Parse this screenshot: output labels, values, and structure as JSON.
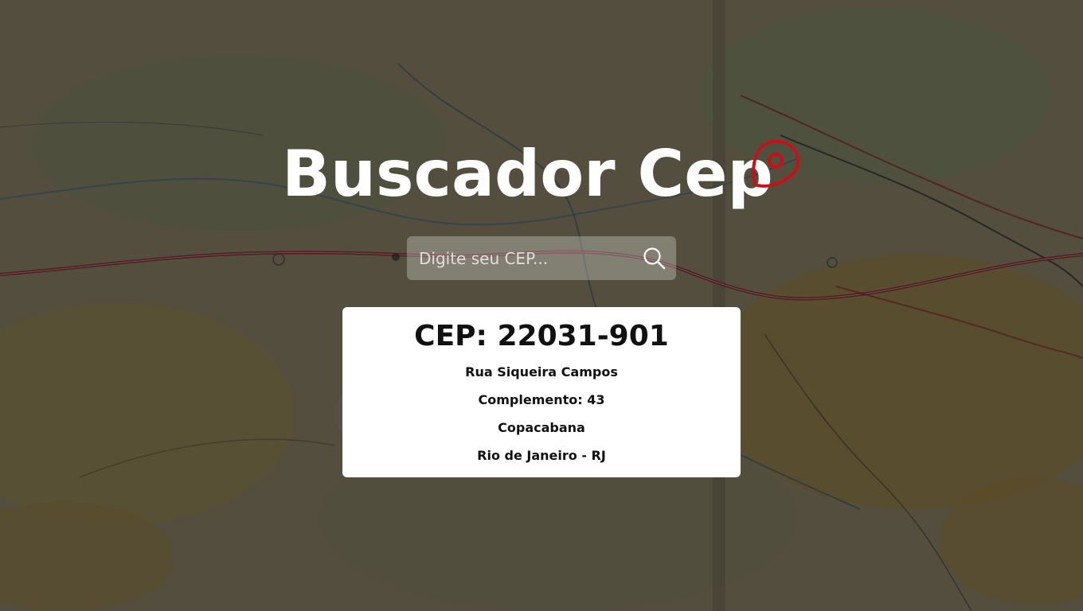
{
  "header": {
    "title": "Buscador Cep",
    "icon": "location-pin-icon",
    "icon_color": "#c8101a"
  },
  "search": {
    "placeholder": "Digite seu CEP...",
    "value": "",
    "button_icon": "search-icon"
  },
  "result": {
    "cep_label": "CEP: 22031-901",
    "street": "Rua Siqueira Campos",
    "complement": "Complemento: 43",
    "neighborhood": "Copacabana",
    "city_state": "Rio de Janeiro - RJ"
  },
  "background": {
    "image": "road-map-background"
  }
}
